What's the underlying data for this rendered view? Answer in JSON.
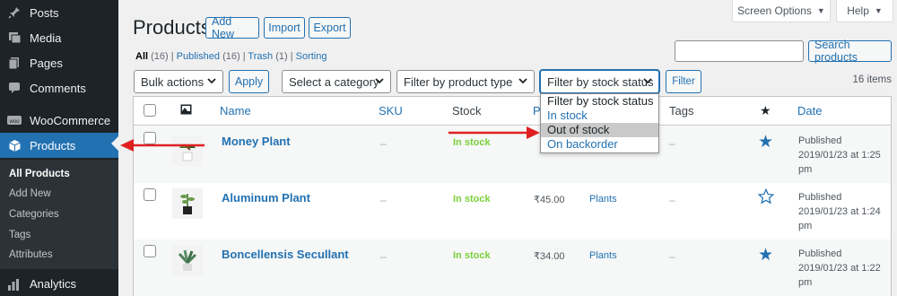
{
  "sidebar": {
    "items": [
      {
        "label": "Posts",
        "icon": "pin-icon"
      },
      {
        "label": "Media",
        "icon": "media-icon"
      },
      {
        "label": "Pages",
        "icon": "pages-icon"
      },
      {
        "label": "Comments",
        "icon": "comments-icon"
      },
      {
        "label": "WooCommerce",
        "icon": "woocommerce-icon"
      },
      {
        "label": "Products",
        "icon": "products-icon"
      }
    ],
    "submenu": [
      "All Products",
      "Add New",
      "Categories",
      "Tags",
      "Attributes"
    ],
    "analytics": {
      "label": "Analytics",
      "icon": "analytics-icon"
    }
  },
  "header": {
    "title": "Products",
    "add_new": "Add New",
    "import": "Import",
    "export": "Export",
    "screen_options": "Screen Options",
    "help": "Help"
  },
  "views": {
    "all": "All",
    "all_count": "(16)",
    "published": "Published",
    "published_count": "(16)",
    "trash": "Trash",
    "trash_count": "(1)",
    "sorting": "Sorting",
    "sep": "|"
  },
  "search": {
    "button": "Search products",
    "value": ""
  },
  "filters": {
    "bulk_actions": "Bulk actions",
    "apply": "Apply",
    "category": "Select a category",
    "product_type": "Filter by product type",
    "stock_status": "Filter by stock status",
    "filter": "Filter",
    "items_count": "16 items",
    "stock_options": [
      "Filter by stock status",
      "In stock",
      "Out of stock",
      "On backorder"
    ],
    "highlighted_option": "Out of stock"
  },
  "table": {
    "columns": {
      "name": "Name",
      "sku": "SKU",
      "stock": "Stock",
      "price": "Pr",
      "tags": "Tags",
      "date": "Date"
    },
    "rows": [
      {
        "name": "Money Plant",
        "sku": "–",
        "stock": "In stock",
        "price": "",
        "categories": "",
        "tags": "–",
        "featured": true,
        "date_status": "Published",
        "date": "2019/01/23 at 1:25 pm"
      },
      {
        "name": "Aluminum Plant",
        "sku": "–",
        "stock": "In stock",
        "price": "₹45.00",
        "categories": "Plants",
        "tags": "–",
        "featured": false,
        "date_status": "Published",
        "date": "2019/01/23 at 1:24 pm"
      },
      {
        "name": "Boncellensis Secullant",
        "sku": "–",
        "stock": "In stock",
        "price": "₹34.00",
        "categories": "Plants",
        "tags": "–",
        "featured": true,
        "date_status": "Published",
        "date": "2019/01/23 at 1:22 pm"
      }
    ]
  },
  "colors": {
    "accent": "#2271b1",
    "sidebar": "#1d2327",
    "instock": "#7ad03a",
    "annotation": "#e02020"
  }
}
